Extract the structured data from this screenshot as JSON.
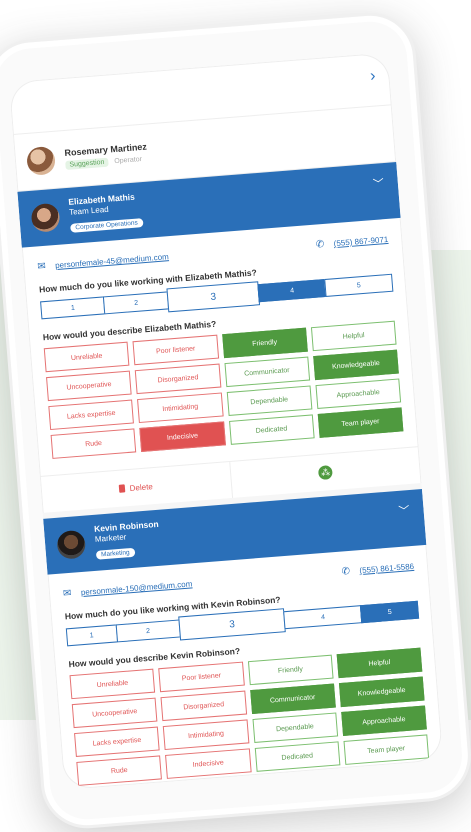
{
  "top": {
    "chevron": "›"
  },
  "rosemary": {
    "name": "Rosemary Martinez",
    "badge": "Suggestion",
    "role": "Operator"
  },
  "cards": [
    {
      "name": "Elizabeth Mathis",
      "role": "Team Lead",
      "dept": "Corporate Operations",
      "email": "personfemale-45@medium.com",
      "phone": "(555) 867-9071",
      "question": "How much do you like working with Elizabeth Mathis?",
      "describe": "How would you describe Elizabeth Mathis?",
      "ratings": [
        "1",
        "2",
        "3",
        "4",
        "5"
      ],
      "selected_rating": 4,
      "tags": [
        [
          "Unreliable",
          "Poor listener",
          "Friendly",
          "Helpful"
        ],
        [
          "Uncooperative",
          "Disorganized",
          "Communicator",
          "Knowledgeable"
        ],
        [
          "Lacks expertise",
          "Intimidating",
          "Dependable",
          "Approachable"
        ],
        [
          "Rude",
          "Indecisive",
          "Dedicated",
          "Team player"
        ]
      ],
      "active_tags": [
        "Indecisive",
        "Friendly",
        "Knowledgeable",
        "Team player"
      ]
    },
    {
      "name": "Kevin Robinson",
      "role": "Marketer",
      "dept": "Marketing",
      "email": "personmale-150@medium.com",
      "phone": "(555) 861-5586",
      "question": "How much do you like working with Kevin Robinson?",
      "describe": "How would you describe Kevin Robinson?",
      "ratings": [
        "1",
        "2",
        "3",
        "4",
        "5"
      ],
      "selected_rating": 5,
      "tags": [
        [
          "Unreliable",
          "Poor listener",
          "Friendly",
          "Helpful"
        ],
        [
          "Uncooperative",
          "Disorganized",
          "Communicator",
          "Knowledgeable"
        ],
        [
          "Lacks expertise",
          "Intimidating",
          "Dependable",
          "Approachable"
        ],
        [
          "Rude",
          "Indecisive",
          "Dedicated",
          "Team player"
        ]
      ],
      "active_tags": [
        "Helpful",
        "Communicator",
        "Knowledgeable",
        "Approachable"
      ]
    }
  ],
  "actions": {
    "delete": "Delete"
  },
  "colors": {
    "primary": "#2a6fb8",
    "positive": "#4f9a3f",
    "negative": "#e05252",
    "background": "#edf5ec"
  }
}
